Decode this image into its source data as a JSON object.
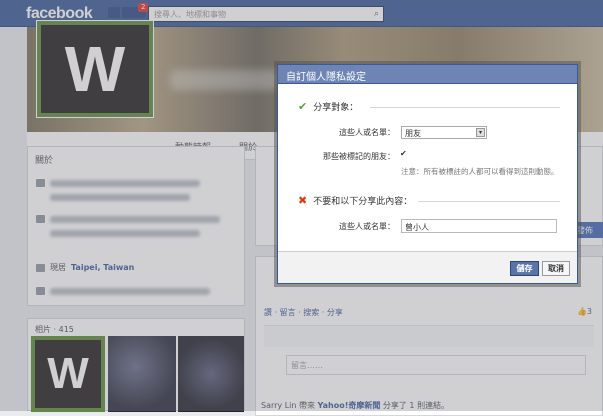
{
  "topbar": {
    "logo": "facebook",
    "notification_count": "2",
    "search_placeholder": "搜尋人、地標和事物"
  },
  "timeline": {
    "tabs": [
      "動態時報",
      "關於"
    ],
    "about_title": "關於",
    "lives_label": "現居",
    "lives_value": "Taipei, Taiwan",
    "photos_title": "相片 · 415",
    "avatar_letter": "W",
    "post_actions": "讚 · 留言 · 搜索 · 分享",
    "comment_placeholder": "留言……",
    "feed_prefix": "Sarry Lin 帶來",
    "feed_link": "Yahoo!奇摩新聞",
    "feed_suffix": "分享了 1 則連結。",
    "publish_label": "發佈"
  },
  "dialog": {
    "title": "自訂個人隱私設定",
    "share_section": "分享對象：",
    "people_label": "這些人或名單：",
    "people_value": "朋友",
    "tagged_label": "那些被標記的朋友：",
    "tagged_checked": "✔",
    "note": "注意：所有被標註的人都可以看得到這則動態。",
    "hide_section": "不要和以下分享此內容：",
    "hide_label": "這些人或名單：",
    "hide_value": "曾小人",
    "save_label": "儲存",
    "cancel_label": "取消"
  }
}
